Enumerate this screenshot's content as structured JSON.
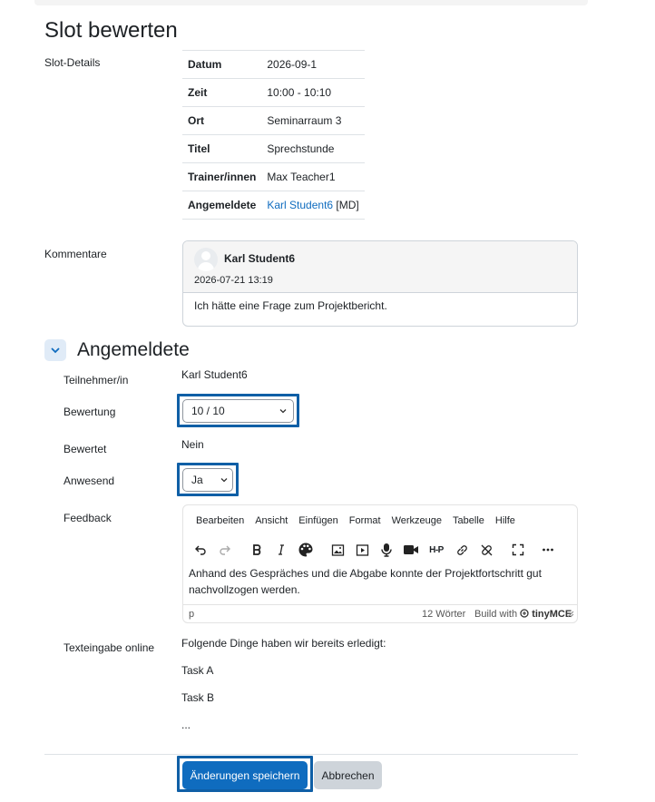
{
  "page": {
    "title": "Slot bewerten"
  },
  "slot_details": {
    "label": "Slot-Details",
    "rows": [
      {
        "key": "Datum",
        "value": "2026-09-1"
      },
      {
        "key": "Zeit",
        "value": "10:00 - 10:10"
      },
      {
        "key": "Ort",
        "value": "Seminarraum 3"
      },
      {
        "key": "Titel",
        "value": "Sprechstunde"
      },
      {
        "key": "Trainer/innen",
        "value": "Max Teacher1"
      },
      {
        "key": "Angemeldete",
        "value": "Karl Student6",
        "suffix": "[MD]"
      }
    ]
  },
  "comments": {
    "label": "Kommentare",
    "author": "Karl Student6",
    "date": "2026-07-21 13:19",
    "text": "Ich hätte eine Frage zum Projektbericht."
  },
  "section": {
    "title": "Angemeldete",
    "participant_label": "Teilnehmer/in",
    "participant_value": "Karl Student6",
    "grade_label": "Bewertung",
    "grade_value": "10 / 10",
    "graded_label": "Bewertet",
    "graded_value": "Nein",
    "attended_label": "Anwesend",
    "attended_value": "Ja",
    "feedback_label": "Feedback",
    "online_label": "Texteingabe online"
  },
  "editor": {
    "menu": [
      "Bearbeiten",
      "Ansicht",
      "Einfügen",
      "Format",
      "Werkzeuge",
      "Tabelle",
      "Hilfe"
    ],
    "h5p_label": "H-P",
    "body": "Anhand des Gespräches und die Abgabe konnte der Projektfortschritt gut nachvollzogen werden.",
    "status_path": "p",
    "word_count": "12 Wörter",
    "build_with": "Build with",
    "brand": "tinyMCE"
  },
  "online_text": {
    "lines": [
      "Folgende Dinge haben wir bereits erledigt:",
      "Task A",
      "Task B",
      "..."
    ]
  },
  "buttons": {
    "save": "Änderungen speichern",
    "cancel": "Abbrechen"
  },
  "colors": {
    "primary": "#0f6cbf",
    "focus": "#0f5fa6",
    "secondary_btn": "#ced4da"
  }
}
